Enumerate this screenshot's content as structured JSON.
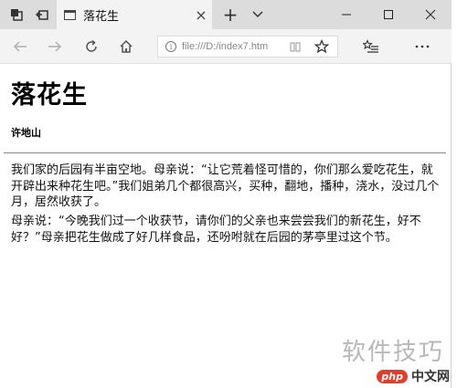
{
  "browser": {
    "tab": {
      "title": "落花生"
    },
    "address": {
      "url": "file:///D:/index7.htm"
    }
  },
  "page": {
    "heading": "落花生",
    "author": "许地山",
    "paragraphs": [
      "我们家的后园有半亩空地。母亲说：“让它荒着怪可惜的，你们那么爱吃花生，就开辟出来种花生吧。”我们姐弟几个都很高兴，买种，翻地，播种，浇水，没过几个月，居然收获了。",
      "母亲说：“今晚我们过一个收获节，请你们的父亲也来尝尝我们的新花生，好不好？”母亲把花生做成了好几样食品，还吩咐就在后园的茅亭里过这个节。"
    ]
  },
  "watermark": {
    "text": "软件技巧",
    "logo_badge": "php",
    "logo_text": "中文网"
  }
}
